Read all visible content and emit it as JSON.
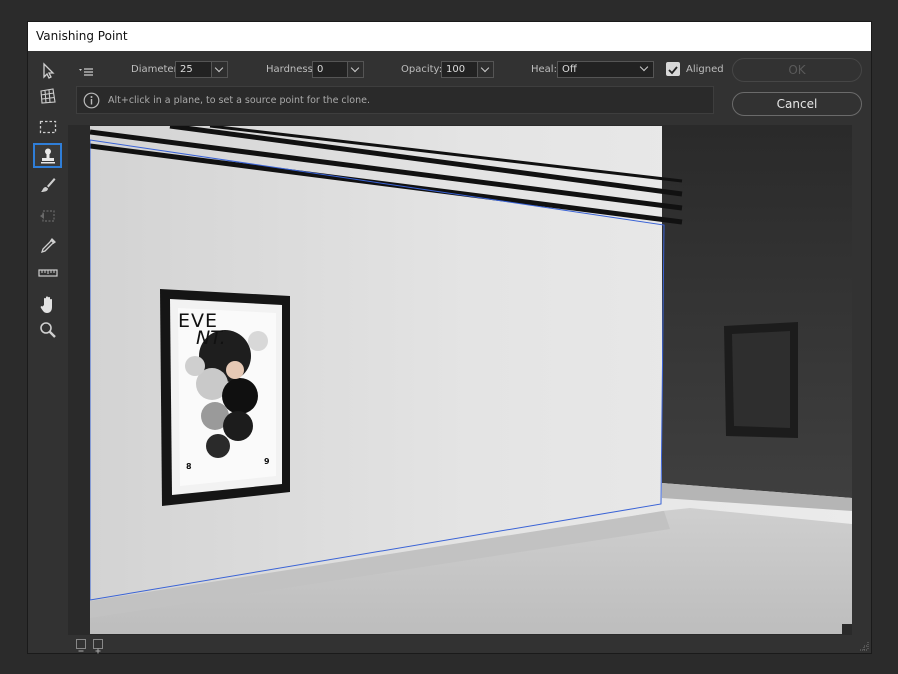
{
  "window": {
    "title": "Vanishing Point"
  },
  "toolbar": {
    "tools": [
      {
        "name": "edit-plane-tool",
        "icon": "pointer-arrow-icon"
      },
      {
        "name": "create-plane-tool",
        "icon": "grid-plane-icon"
      },
      {
        "name": "marquee-tool",
        "icon": "marquee-icon"
      },
      {
        "name": "stamp-tool",
        "icon": "clone-stamp-icon",
        "active": true
      },
      {
        "name": "brush-tool",
        "icon": "brush-icon"
      },
      {
        "name": "transform-tool",
        "icon": "transform-icon",
        "disabled": true
      },
      {
        "name": "eyedropper-tool",
        "icon": "eyedropper-icon"
      },
      {
        "name": "measure-tool",
        "icon": "ruler-icon"
      },
      {
        "name": "hand-tool",
        "icon": "hand-icon"
      },
      {
        "name": "zoom-tool",
        "icon": "zoom-icon"
      }
    ]
  },
  "options": {
    "diameter_label": "Diameter:",
    "diameter_value": "25",
    "hardness_label": "Hardness:",
    "hardness_value": "0",
    "opacity_label": "Opacity:",
    "opacity_value": "100",
    "heal_label": "Heal:",
    "heal_value": "Off",
    "aligned_label": "Aligned",
    "aligned_checked": true
  },
  "info": {
    "message": "Alt+click in a plane, to set a source point for the clone."
  },
  "buttons": {
    "ok": "OK",
    "cancel": "Cancel"
  },
  "poster": {
    "headline_line1": "EVE",
    "headline_line2": "NT.",
    "date_left": "8",
    "date_right": "9"
  },
  "colors": {
    "accent": "#2f7ed8",
    "plane_outline": "#3a63d6"
  }
}
